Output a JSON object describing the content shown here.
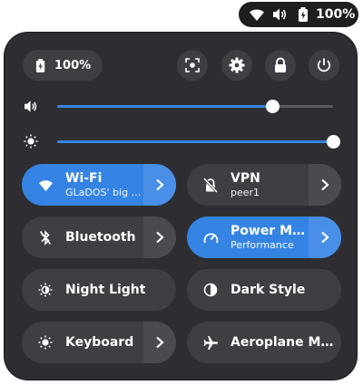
{
  "topbar": {
    "wifi_icon": "wifi-icon",
    "volume_icon": "volume-icon",
    "battery_icon": "battery-charging-icon",
    "battery_label": "100%"
  },
  "panel": {
    "battery_label": "100%",
    "buttons": [
      {
        "name": "screenshot-button",
        "icon": "screenshot-icon"
      },
      {
        "name": "settings-button",
        "icon": "gear-icon"
      },
      {
        "name": "lock-button",
        "icon": "lock-icon"
      },
      {
        "name": "power-button",
        "icon": "power-icon"
      }
    ],
    "volume_level": 0.78,
    "brightness_level": 1.0,
    "tiles": [
      {
        "title": "Wi-Fi",
        "subtitle": "GLaDOS' big …",
        "active": true,
        "arrow": true,
        "icon": "wifi-icon"
      },
      {
        "title": "VPN",
        "subtitle": "peer1",
        "active": false,
        "arrow": true,
        "icon": "vpn-off-icon"
      },
      {
        "title": "Bluetooth",
        "subtitle": "",
        "active": false,
        "arrow": true,
        "icon": "bluetooth-off-icon"
      },
      {
        "title": "Power Mode",
        "subtitle": "Performance",
        "active": true,
        "arrow": true,
        "icon": "power-mode-icon"
      },
      {
        "title": "Night Light",
        "subtitle": "",
        "active": false,
        "arrow": false,
        "icon": "night-light-icon"
      },
      {
        "title": "Dark Style",
        "subtitle": "",
        "active": false,
        "arrow": false,
        "icon": "dark-style-icon"
      },
      {
        "title": "Keyboard",
        "subtitle": "",
        "active": false,
        "arrow": true,
        "icon": "keyboard-brightness-icon"
      },
      {
        "title": "Aeroplane Mode",
        "subtitle": "",
        "active": false,
        "arrow": false,
        "icon": "aeroplane-icon"
      }
    ]
  },
  "colors": {
    "accent": "#3584e4",
    "panel_bg": "#2e2e32",
    "tile_bg": "#3e3e43"
  }
}
